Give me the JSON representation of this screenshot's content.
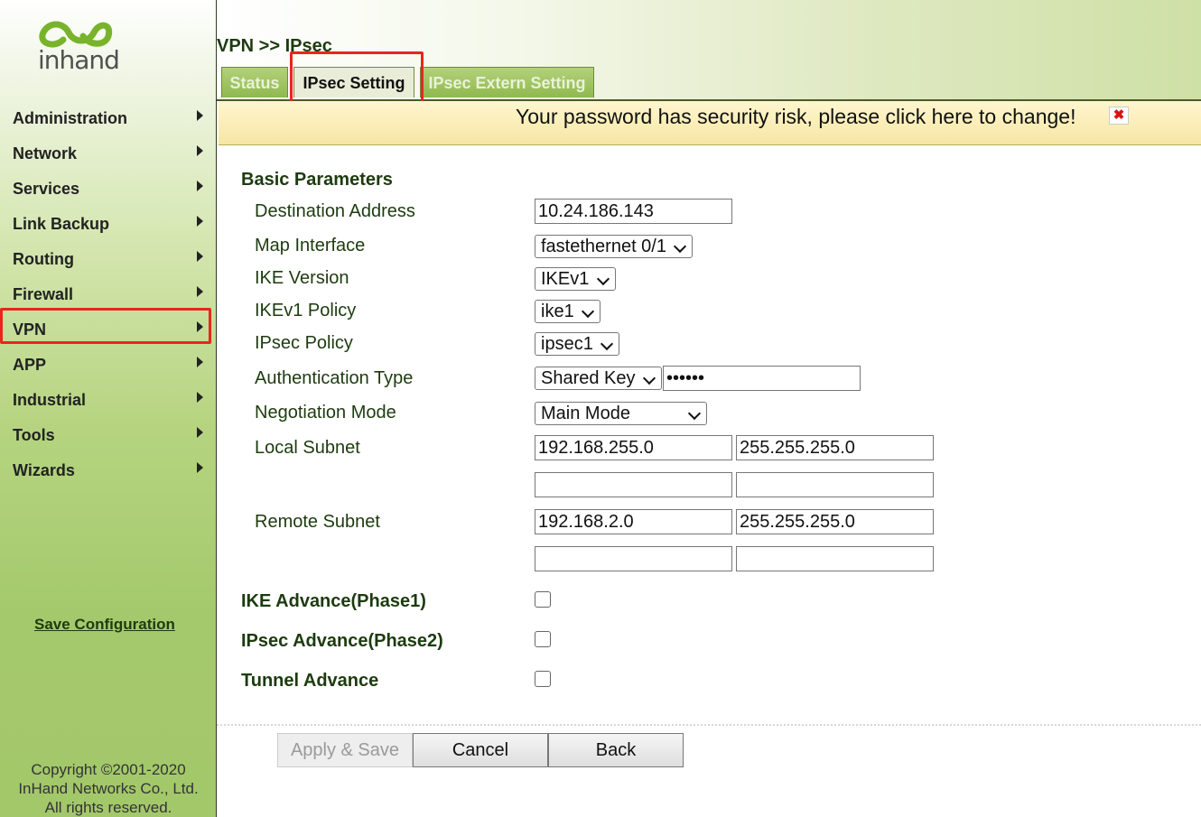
{
  "app": {
    "logo_text": "inhand"
  },
  "sidebar": {
    "items": [
      {
        "label": "Administration"
      },
      {
        "label": "Network"
      },
      {
        "label": "Services"
      },
      {
        "label": "Link Backup"
      },
      {
        "label": "Routing"
      },
      {
        "label": "Firewall"
      },
      {
        "label": "VPN"
      },
      {
        "label": "APP"
      },
      {
        "label": "Industrial"
      },
      {
        "label": "Tools"
      },
      {
        "label": "Wizards"
      }
    ],
    "save_configuration": "Save Configuration",
    "copyright": [
      "Copyright ©2001-2020",
      "InHand Networks Co., Ltd.",
      "All rights reserved."
    ]
  },
  "header": {
    "breadcrumb": "VPN >> IPsec",
    "tabs": [
      {
        "label": "Status",
        "active": false
      },
      {
        "label": "IPsec Setting",
        "active": true
      },
      {
        "label": "IPsec Extern Setting",
        "active": false
      }
    ]
  },
  "warning": {
    "text": "Your password has security risk, please click here to change!",
    "close": "✖"
  },
  "form": {
    "basic_parameters": "Basic Parameters",
    "destination_address": {
      "label": "Destination Address",
      "value": "10.24.186.143"
    },
    "map_interface": {
      "label": "Map Interface",
      "value": "fastethernet 0/1"
    },
    "ike_version": {
      "label": "IKE Version",
      "value": "IKEv1"
    },
    "ikev1_policy": {
      "label": "IKEv1 Policy",
      "value": "ike1"
    },
    "ipsec_policy": {
      "label": "IPsec Policy",
      "value": "ipsec1"
    },
    "authentication_type": {
      "label": "Authentication Type",
      "value": "Shared Key",
      "key_value": "••••••"
    },
    "negotiation_mode": {
      "label": "Negotiation Mode",
      "value": "Main Mode"
    },
    "local_subnet": {
      "label": "Local Subnet",
      "rows": [
        [
          "192.168.255.0",
          "255.255.255.0"
        ],
        [
          "",
          ""
        ]
      ]
    },
    "remote_subnet": {
      "label": "Remote Subnet",
      "rows": [
        [
          "192.168.2.0",
          "255.255.255.0"
        ],
        [
          "",
          ""
        ]
      ]
    },
    "ike_advance": {
      "label": "IKE Advance(Phase1)",
      "checked": false
    },
    "ipsec_advance": {
      "label": "IPsec Advance(Phase2)",
      "checked": false
    },
    "tunnel_advance": {
      "label": "Tunnel Advance",
      "checked": false
    }
  },
  "buttons": {
    "apply_save": "Apply & Save",
    "cancel": "Cancel",
    "back": "Back"
  },
  "colors": {
    "highlight": "#e8261d",
    "sidebar_green": "#a4c96c",
    "warning_bg": "#fff6cf"
  }
}
